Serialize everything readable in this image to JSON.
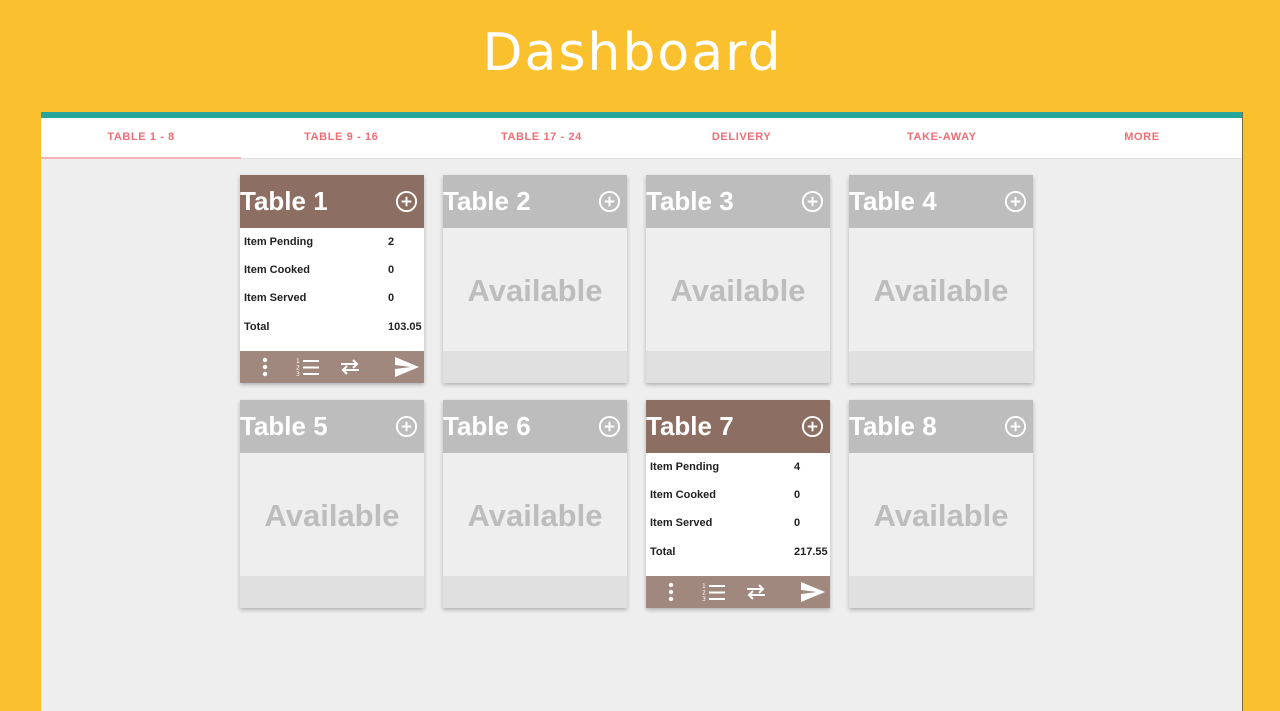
{
  "title": "Dashboard",
  "tabs": [
    {
      "label": "TABLE 1 - 8",
      "active": true
    },
    {
      "label": "TABLE 9 - 16",
      "active": false
    },
    {
      "label": "TABLE 17 - 24",
      "active": false
    },
    {
      "label": "DELIVERY",
      "active": false
    },
    {
      "label": "TAKE-AWAY",
      "active": false
    },
    {
      "label": "MORE",
      "active": false
    }
  ],
  "available_label": "Available",
  "stat_labels": {
    "pending": "Item Pending",
    "cooked": "Item Cooked",
    "served": "Item Served",
    "total": "Total"
  },
  "tables": [
    {
      "name": "Table 1",
      "occupied": true,
      "pending": "2",
      "cooked": "0",
      "served": "0",
      "total": "103.05"
    },
    {
      "name": "Table 2",
      "occupied": false
    },
    {
      "name": "Table 3",
      "occupied": false
    },
    {
      "name": "Table 4",
      "occupied": false
    },
    {
      "name": "Table 5",
      "occupied": false
    },
    {
      "name": "Table 6",
      "occupied": false
    },
    {
      "name": "Table 7",
      "occupied": true,
      "pending": "4",
      "cooked": "0",
      "served": "0",
      "total": "217.55"
    },
    {
      "name": "Table 8",
      "occupied": false
    }
  ],
  "footer_icons": [
    "more-vert-icon",
    "numbered-list-icon",
    "swap-icon",
    "send-icon"
  ],
  "colors": {
    "background": "#FBC02D",
    "accent_bar": "#26A69A",
    "tab_text": "#EE6E73",
    "occupied_header": "#8D6E63",
    "occupied_footer": "#A1887F",
    "available_header": "#BDBDBD"
  }
}
